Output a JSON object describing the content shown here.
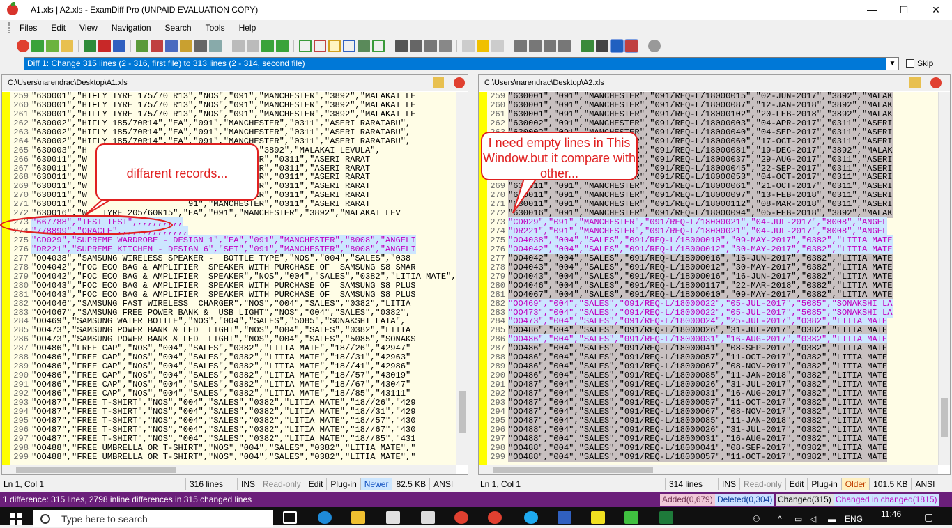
{
  "window": {
    "title": "A1.xls | A2.xls - ExamDiff Pro (UNPAID EVALUATION COPY)",
    "minimize": "—",
    "maximize": "☐",
    "close": "✕"
  },
  "menu": [
    "Files",
    "Edit",
    "View",
    "Navigation",
    "Search",
    "Tools",
    "Help"
  ],
  "diff_selector": {
    "value": "Diff 1: Change 315 lines (2 - 316, first file) to 313 lines (2 - 314, second file)"
  },
  "skip_label": "Skip",
  "left": {
    "path": "C:\\Users\\narendrac\\Desktop\\A1.xls",
    "lines": [
      {
        "n": "259",
        "t": "\"630001\",\"HIFLY TYRE 175/70 R13\",\"NOS\",\"091\",\"MANCHESTER\",\"3892\",\"MALAKAI LE"
      },
      {
        "n": "260",
        "t": "\"630001\",\"HIFLY TYRE 175/70 R13\",\"NOS\",\"091\",\"MANCHESTER\",\"3892\",\"MALAKAI LE"
      },
      {
        "n": "261",
        "t": "\"630001\",\"HIFLY TYRE 175/70 R13\",\"NOS\",\"091\",\"MANCHESTER\",\"3892\",\"MALAKAI LE"
      },
      {
        "n": "262",
        "t": "\"630002\",\"HIFLY 185/70R14\",\"EA\",\"091\",\"MANCHESTER\",\"0311\",\"ASERI RARATABU\","
      },
      {
        "n": "263",
        "t": "\"630002\",\"HIFLY 185/70R14\",\"EA\",\"091\",\"MANCHESTER\",\"0311\",\"ASERI RARATABU\","
      },
      {
        "n": "264",
        "t": "\"630002\",\"HIFLY 185/70R14\",\"EA\",\"091\",\"MANCHESTER\",\"0311\",\"ASERI RARATABU\","
      },
      {
        "n": "265",
        "t": "\"630003\",\"H                   \",\"MANCHESTER\",\"3892\",\"MALAKAI LEVULA\","
      },
      {
        "n": "266",
        "t": "\"630011\",\"W                    91\",\"MANCHESTER\",\"0311\",\"ASERI RARAT"
      },
      {
        "n": "267",
        "t": "\"630011\",\"W                    91\",\"MANCHESTER\",\"0311\",\"ASERI RARAT"
      },
      {
        "n": "268",
        "t": "\"630011\",\"W                    91\",\"MANCHESTER\",\"0311\",\"ASERI RARAT"
      },
      {
        "n": "269",
        "t": "\"630011\",\"W                    91\",\"MANCHESTER\",\"0311\",\"ASERI RARAT"
      },
      {
        "n": "270",
        "t": "\"630011\",\"W                    91\",\"MANCHESTER\",\"0311\",\"ASERI RARAT"
      },
      {
        "n": "271",
        "t": "\"630011\",\"W                    91\",\"MANCHESTER\",\"0311\",\"ASERI RARAT"
      },
      {
        "n": "272",
        "t": "\"630016\",\"W   TYRE 205/60R15\",\"EA\",\"091\",\"MANCHESTER\",\"3892\",\"MALAKAI LEV"
      },
      {
        "n": "273",
        "t": "\"667788\",\"TEST TEST\",,,,,,,,,,",
        "c": "mod"
      },
      {
        "n": "274",
        "t": "\"778899\",\"ORACLE\",,,,,,,,,,,,,,",
        "c": "mod"
      },
      {
        "n": "275",
        "t": "\"CD029\",\"SUPREME WARDROBE - DESIGN 1\",\"EA\",\"091\",\"MANCHESTER\",\"8008\",\"ANGELI",
        "c": "mod"
      },
      {
        "n": "276",
        "t": "\"DR221\",\"SUPREME KITCHEN - DESIGN 6\",\"SET\",\"091\",\"MANCHESTER\",\"8008\",\"ANGELI",
        "c": "mod"
      },
      {
        "n": "277",
        "t": "\"OO4038\",\"SAMSUNG WIRELESS SPEAKER -  BOTTLE TYPE\",\"NOS\",\"004\",\"SALES\",\"038"
      },
      {
        "n": "278",
        "t": "\"OO4042\",\"FOC ECO BAG & AMPLIFIER  SPEAKER WITH PURCHASE OF  SAMSUNG S8 SMAR"
      },
      {
        "n": "279",
        "t": "\"OO4042\",\"FOC ECO BAG & AMPLIFIER  SPEAKER\",\"NOS\",\"004\",\"SALES\",\"0382\",\"LITIA MATE\","
      },
      {
        "n": "280",
        "t": "\"OO4043\",\"FOC ECO BAG & AMPLIFIER  SPEAKER WITH PURCHASE OF  SAMSUNG S8 PLUS"
      },
      {
        "n": "281",
        "t": "\"OO4043\",\"FOC ECO BAG & AMPLIFIER  SPEAKER WITH PURCHASE OF  SAMSUNG S8 PLUS"
      },
      {
        "n": "282",
        "t": "\"OO4046\",\"SAMSUNG FAST WIRELESS  CHARGER\",\"NOS\",\"004\",\"SALES\",\"0382\",\"LITIA"
      },
      {
        "n": "283",
        "t": "\"OO4067\",\"SAMSUNG FREE POWER BANK &  USB LIGHT\",\"NOS\",\"004\",\"SALES\",\"0382\","
      },
      {
        "n": "284",
        "t": "\"OO469\",\"SAMSUNG WATER BOTTLE\",\"NOS\",\"004\",\"SALES\",\"5085\",\"SONAKSHI LATA\","
      },
      {
        "n": "285",
        "t": "\"OO473\",\"SAMSUNG POWER BANK & LED  LIGHT\",\"NOS\",\"004\",\"SALES\",\"0382\",\"LITIA"
      },
      {
        "n": "286",
        "t": "\"OO473\",\"SAMSUNG POWER BANK & LED  LIGHT\",\"NOS\",\"004\",\"SALES\",\"5085\",\"SONAKS"
      },
      {
        "n": "287",
        "t": "\"OO486\",\"FREE CAP\",\"NOS\",\"004\",\"SALES\",\"0382\",\"LITIA MATE\",\"18//26\",\"42947\""
      },
      {
        "n": "288",
        "t": "\"OO486\",\"FREE CAP\",\"NOS\",\"004\",\"SALES\",\"0382\",\"LITIA MATE\",\"18//31\",\"42963\""
      },
      {
        "n": "289",
        "t": "\"OO486\",\"FREE CAP\",\"NOS\",\"004\",\"SALES\",\"0382\",\"LITIA MATE\",\"18//41\",\"42986\""
      },
      {
        "n": "290",
        "t": "\"OO486\",\"FREE CAP\",\"NOS\",\"004\",\"SALES\",\"0382\",\"LITIA MATE\",\"18//57\",\"43019\""
      },
      {
        "n": "291",
        "t": "\"OO486\",\"FREE CAP\",\"NOS\",\"004\",\"SALES\",\"0382\",\"LITIA MATE\",\"18//67\",\"43047\""
      },
      {
        "n": "292",
        "t": "\"OO486\",\"FREE CAP\",\"NOS\",\"004\",\"SALES\",\"0382\",\"LITIA MATE\",\"18//85\",\"43111\""
      },
      {
        "n": "293",
        "t": "\"OO487\",\"FREE T-SHIRT\",\"NOS\",\"004\",\"SALES\",\"0382\",\"LITIA MATE\",\"18//26\",\"429"
      },
      {
        "n": "294",
        "t": "\"OO487\",\"FREE T-SHIRT\",\"NOS\",\"004\",\"SALES\",\"0382\",\"LITIA MATE\",\"18//31\",\"429"
      },
      {
        "n": "295",
        "t": "\"OO487\",\"FREE T-SHIRT\",\"NOS\",\"004\",\"SALES\",\"0382\",\"LITIA MATE\",\"18//57\",\"430"
      },
      {
        "n": "296",
        "t": "\"OO487\",\"FREE T-SHIRT\",\"NOS\",\"004\",\"SALES\",\"0382\",\"LITIA MATE\",\"18//67\",\"430"
      },
      {
        "n": "297",
        "t": "\"OO487\",\"FREE T-SHIRT\",\"NOS\",\"004\",\"SALES\",\"0382\",\"LITIA MATE\",\"18//85\",\"431"
      },
      {
        "n": "298",
        "t": "\"OO488\",\"FREE UMBRELLA OR T-SHIRT\",\"NOS\",\"004\",\"SALES\",\"0382\",\"LITIA MATE\",\""
      },
      {
        "n": "299",
        "t": "\"OO488\",\"FREE UMBRELLA OR T-SHIRT\",\"NOS\",\"004\",\"SALES\",\"0382\",\"LITIA MATE\",\""
      }
    ],
    "status": {
      "pos": "Ln 1, Col 1",
      "lines": "316 lines",
      "ins": "INS",
      "ro": "Read-only",
      "edit": "Edit",
      "plugin": "Plug-in",
      "age": "Newer",
      "size": "82.5 KB",
      "enc": "ANSI"
    }
  },
  "right": {
    "path": "C:\\Users\\narendrac\\Desktop\\A2.xls",
    "lines": [
      {
        "n": "259",
        "t": "\"630001\",\"091\",\"MANCHESTER\",\"091/REQ-L/18000015\",\"02-JUN-2017\",\"3892\",\"MALAK"
      },
      {
        "n": "260",
        "t": "\"630001\",\"091\",\"MANCHESTER\",\"091/REQ-L/18000087\",\"12-JAN-2018\",\"3892\",\"MALAK"
      },
      {
        "n": "261",
        "t": "\"630001\",\"091\",\"MANCHESTER\",\"091/REQ-L/18000102\",\"20-FEB-2018\",\"3892\",\"MALAK"
      },
      {
        "n": "262",
        "t": "\"630002\",\"091\",\"MANCHESTER\",\"091/REQ-L/18000003\",\"04-APR-2017\",\"0311\",\"ASERI"
      },
      {
        "n": "263",
        "t": "\"630002\",\"091\",\"MANCHESTER\",\"091/REQ-L/18000040\",\"04-SEP-2017\",\"0311\",\"ASERI"
      },
      {
        "n": "264",
        "t": "\"630002\",\"091\",\"MANCHESTER\",\"091/REQ-L/18000060\",\"17-OCT-2017\",\"0311\",\"ASERI"
      },
      {
        "n": "265",
        "t": "\"630003\",\"091\",\"MANCHESTER\",\"091/REQ-L/18000081\",\"19-DEC-2017\",\"3892\",\"MALAK"
      },
      {
        "n": "266",
        "t": "\"630011\",\"091\",\"MANCHESTER\",\"091/REQ-L/18000037\",\"29-AUG-2017\",\"0311\",\"ASERI"
      },
      {
        "n": "267",
        "t": "\"630011\",\"091\",\"MANCHESTER\",\"091/REQ-L/18000045\",\"22-SEP-2017\",\"0311\",\"ASERI"
      },
      {
        "n": "268",
        "t": "\"630011\",\"091\",\"MANCHESTER\",\"091/REQ-L/18000053\",\"04-OCT-2017\",\"0311\",\"ASERI"
      },
      {
        "n": "269",
        "t": "\"630011\",\"091\",\"MANCHESTER\",\"091/REQ-L/18000061\",\"21-OCT-2017\",\"0311\",\"ASERI"
      },
      {
        "n": "270",
        "t": "\"630011\",\"091\",\"MANCHESTER\",\"091/REQ-L/18000097\",\"13-FEB-2018\",\"0311\",\"ASERI"
      },
      {
        "n": "271",
        "t": "\"630011\",\"091\",\"MANCHESTER\",\"091/REQ-L/18000112\",\"08-MAR-2018\",\"0311\",\"ASERI"
      },
      {
        "n": "272",
        "t": "\"630016\",\"091\",\"MANCHESTER\",\"091/REQ-L/18000094\",\"05-FEB-2018\",\"3892\",\"MALAK"
      },
      {
        "n": "273",
        "t": "\"CD029\",\"091\",\"MANCHESTER\",\"091/REQ-L/18000021\",\"04-JUL-2017\",\"8008\",\"ANGEL",
        "c": "mod"
      },
      {
        "n": "274",
        "t": "\"DR221\",\"091\",\"MANCHESTER\",\"091/REQ-L/18000021\",\"04-JUL-2017\",\"8008\",\"ANGEL",
        "c": "mod"
      },
      {
        "n": "275",
        "t": "\"OO4038\",\"004\",\"SALES\",\"091/REQ-L/18000010\",\"09-MAY-2017\",\"0382\",\"LITIA MATE",
        "c": "mod"
      },
      {
        "n": "276",
        "t": "\"OO4042\",\"004\",\"SALES\",\"091/REQ-L/18000012\",\"30-MAY-2017\",\"0382\",\"LITIA MATE",
        "c": "mod"
      },
      {
        "n": "277",
        "t": "\"OO4042\",\"004\",\"SALES\",\"091/REQ-L/18000016\",\"16-JUN-2017\",\"0382\",\"LITIA MATE"
      },
      {
        "n": "278",
        "t": "\"OO4043\",\"004\",\"SALES\",\"091/REQ-L/18000012\",\"30-MAY-2017\",\"0382\",\"LITIA MATE"
      },
      {
        "n": "279",
        "t": "\"OO4043\",\"004\",\"SALES\",\"091/REQ-L/18000016\",\"16-JUN-2017\",\"0382\",\"LITIA MATE"
      },
      {
        "n": "280",
        "t": "\"OO4046\",\"004\",\"SALES\",\"091/REQ-L/18000117\",\"22-MAR-2018\",\"0382\",\"LITIA MATE"
      },
      {
        "n": "281",
        "t": "\"OO4067\",\"004\",\"SALES\",\"091/REQ-L/18000010\",\"09-MAY-2017\",\"0382\",\"LITIA MATE"
      },
      {
        "n": "282",
        "t": "\"OO469\",\"004\",\"SALES\",\"091/REQ-L/18000022\",\"05-JUL-2017\",\"5085\",\"SONAKSHI LA",
        "c": "mod"
      },
      {
        "n": "283",
        "t": "\"OO473\",\"004\",\"SALES\",\"091/REQ-L/18000022\",\"05-JUL-2017\",\"5085\",\"SONAKSHI LA",
        "c": "mod"
      },
      {
        "n": "284",
        "t": "\"OO473\",\"004\",\"SALES\",\"091/REQ-L/18000024\",\"25-JUL-2017\",\"0382\",\"LITIA MATE",
        "c": "mod"
      },
      {
        "n": "285",
        "t": "\"OO486\",\"004\",\"SALES\",\"091/REQ-L/18000026\",\"31-JUL-2017\",\"0382\",\"LITIA MATE"
      },
      {
        "n": "286",
        "t": "\"OO486\",\"004\",\"SALES\",\"091/REQ-L/18000031\",\"16-AUG-2017\",\"0382\",\"LITIA MATE",
        "c": "mod"
      },
      {
        "n": "287",
        "t": "\"OO486\",\"004\",\"SALES\",\"091/REQ-L/18000041\",\"08-SEP-2017\",\"0382\",\"LITIA MATE"
      },
      {
        "n": "288",
        "t": "\"OO486\",\"004\",\"SALES\",\"091/REQ-L/18000057\",\"11-OCT-2017\",\"0382\",\"LITIA MATE"
      },
      {
        "n": "289",
        "t": "\"OO486\",\"004\",\"SALES\",\"091/REQ-L/18000067\",\"08-NOV-2017\",\"0382\",\"LITIA MATE"
      },
      {
        "n": "290",
        "t": "\"OO486\",\"004\",\"SALES\",\"091/REQ-L/18000085\",\"11-JAN-2018\",\"0382\",\"LITIA MATE"
      },
      {
        "n": "291",
        "t": "\"OO487\",\"004\",\"SALES\",\"091/REQ-L/18000026\",\"31-JUL-2017\",\"0382\",\"LITIA MATE"
      },
      {
        "n": "292",
        "t": "\"OO487\",\"004\",\"SALES\",\"091/REQ-L/18000031\",\"16-AUG-2017\",\"0382\",\"LITIA MATE"
      },
      {
        "n": "293",
        "t": "\"OO487\",\"004\",\"SALES\",\"091/REQ-L/18000057\",\"11-OCT-2017\",\"0382\",\"LITIA MATE"
      },
      {
        "n": "294",
        "t": "\"OO487\",\"004\",\"SALES\",\"091/REQ-L/18000067\",\"08-NOV-2017\",\"0382\",\"LITIA MATE"
      },
      {
        "n": "295",
        "t": "\"OO487\",\"004\",\"SALES\",\"091/REQ-L/18000085\",\"11-JAN-2018\",\"0382\",\"LITIA MATE"
      },
      {
        "n": "296",
        "t": "\"OO488\",\"004\",\"SALES\",\"091/REQ-L/18000026\",\"31-JUL-2017\",\"0382\",\"LITIA MATE"
      },
      {
        "n": "297",
        "t": "\"OO488\",\"004\",\"SALES\",\"091/REQ-L/18000031\",\"16-AUG-2017\",\"0382\",\"LITIA MATE"
      },
      {
        "n": "298",
        "t": "\"OO488\",\"004\",\"SALES\",\"091/REQ-L/18000041\",\"08-SEP-2017\",\"0382\",\"LITIA MATE"
      },
      {
        "n": "299",
        "t": "\"OO488\",\"004\",\"SALES\",\"091/REQ-L/18000057\",\"11-OCT-2017\",\"0382\",\"LITIA MATE"
      }
    ],
    "status": {
      "pos": "Ln 1, Col 1",
      "lines": "314 lines",
      "ins": "INS",
      "ro": "Read-only",
      "edit": "Edit",
      "plugin": "Plug-in",
      "age": "Older",
      "size": "101.5 KB",
      "enc": "ANSI"
    }
  },
  "summary": "1 difference: 315 lines, 2798 inline differences in 315 changed lines",
  "legend": {
    "added": "Added(0,679)",
    "deleted": "Deleted(0,304)",
    "changed": "Changed(315)",
    "cic": "Changed in changed(1815)"
  },
  "callouts": {
    "left": "diffarent records...",
    "right": "I need empty lines in This Window.but it compare with other..."
  },
  "taskbar": {
    "search_placeholder": "Type here to search",
    "lang": "ENG",
    "time": "11:46"
  },
  "colors": {
    "accent": "#0078d7",
    "gutter": "#ffff00",
    "modified_text": "#c000c0",
    "modified_bg": "#cce6ff",
    "status_purple": "#6b1f7a"
  }
}
